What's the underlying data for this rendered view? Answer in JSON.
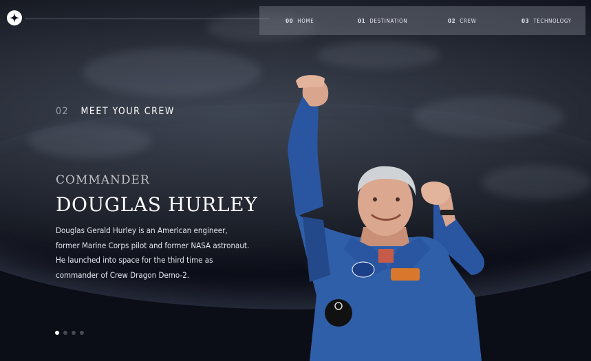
{
  "nav": {
    "items": [
      {
        "num": "00",
        "label": "HOME"
      },
      {
        "num": "01",
        "label": "DESTINATION"
      },
      {
        "num": "02",
        "label": "CREW"
      },
      {
        "num": "03",
        "label": "TECHNOLOGY"
      }
    ]
  },
  "header": {
    "logo_icon": "star-logo-icon"
  },
  "section": {
    "number": "02",
    "title": "MEET YOUR CREW"
  },
  "crew": {
    "role": "COMMANDER",
    "name": "DOUGLAS HURLEY",
    "bio": "Douglas Gerald Hurley is an American engineer, former Marine Corps pilot and former NASA astronaut. He launched into space for the third time as commander of Crew Dragon Demo-2."
  },
  "pagination": {
    "count": 4,
    "active": 0
  },
  "colors": {
    "background": "#0b0d17",
    "suit": "#2f5fa8",
    "text": "#ffffff"
  }
}
